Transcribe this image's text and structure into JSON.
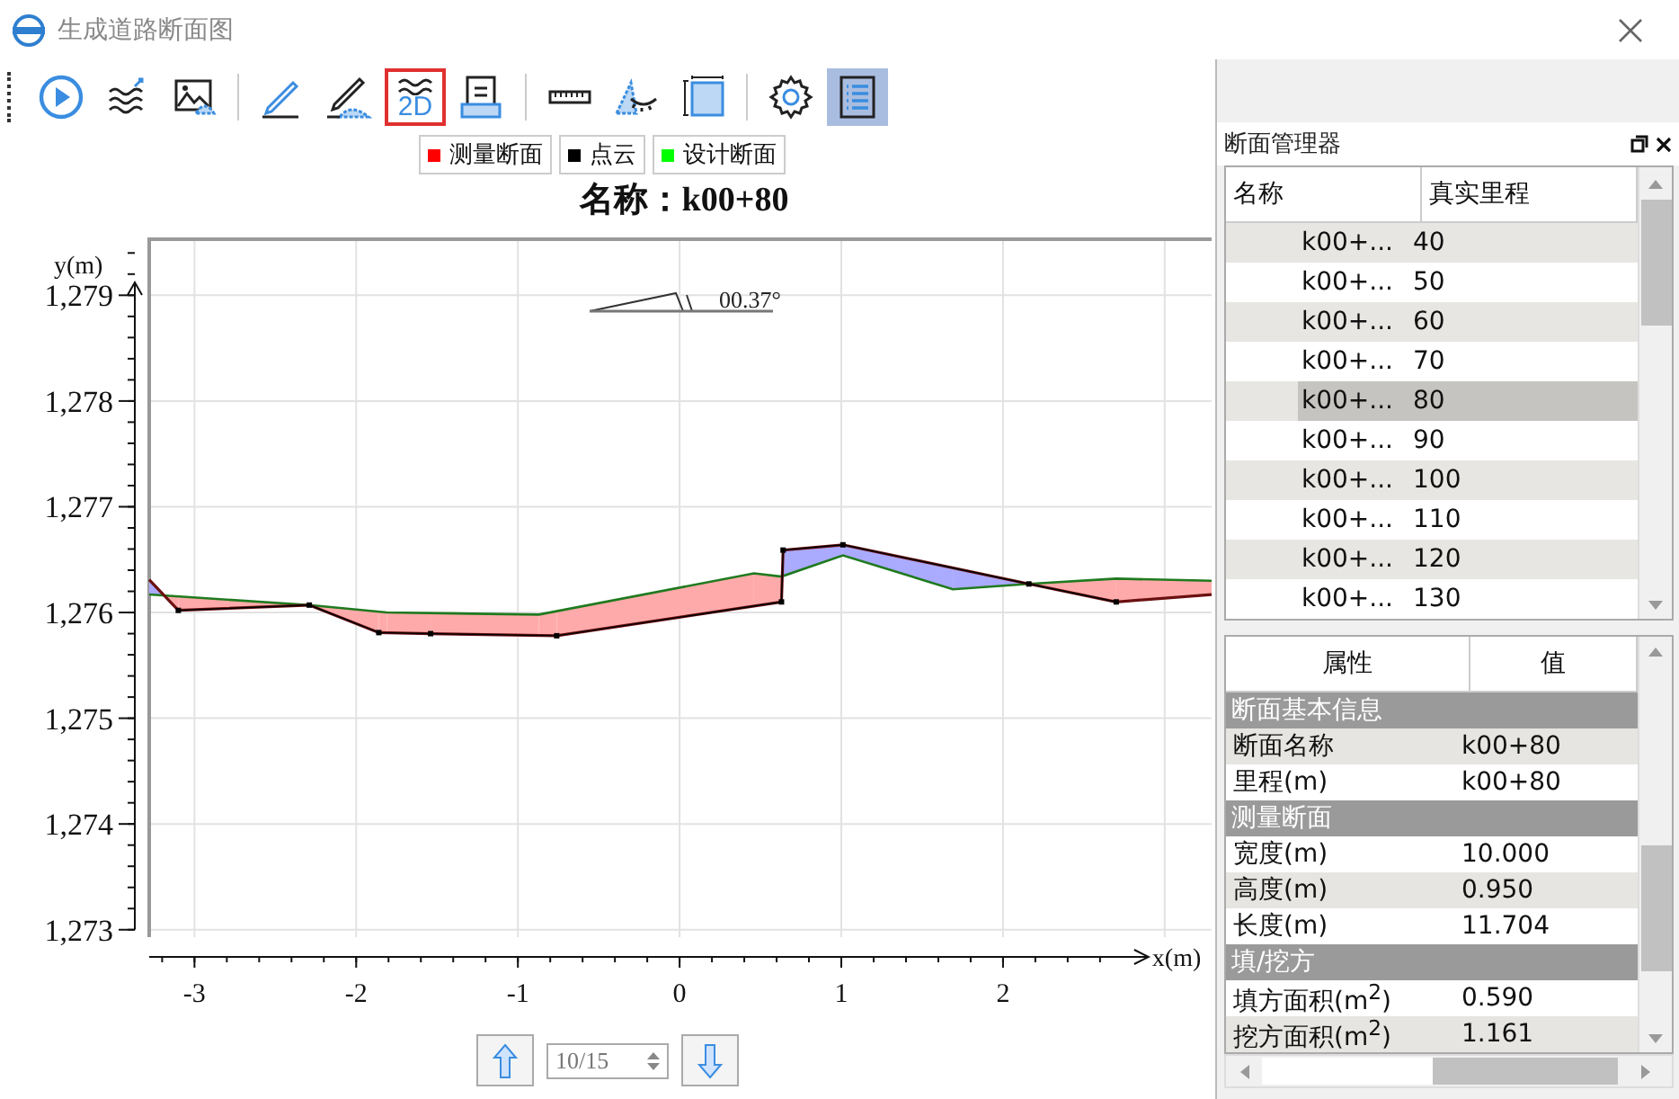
{
  "window": {
    "title": "生成道路断面图"
  },
  "toolbar": [
    {
      "kind": "play",
      "selected": false,
      "on": false
    },
    {
      "kind": "waves",
      "selected": false,
      "on": false
    },
    {
      "kind": "image",
      "selected": false,
      "on": false
    },
    {
      "kind": "separator"
    },
    {
      "kind": "pencil-line",
      "selected": false,
      "on": false
    },
    {
      "kind": "pencil-area",
      "selected": false,
      "on": false
    },
    {
      "kind": "wave-2d",
      "label": "2D",
      "selected": true,
      "on": false
    },
    {
      "kind": "tray",
      "selected": false,
      "on": false
    },
    {
      "kind": "separator"
    },
    {
      "kind": "ruler",
      "selected": false,
      "on": false
    },
    {
      "kind": "eye-area",
      "selected": false,
      "on": false
    },
    {
      "kind": "square",
      "selected": false,
      "on": false
    },
    {
      "kind": "separator"
    },
    {
      "kind": "gear",
      "selected": false,
      "on": false
    },
    {
      "kind": "list",
      "selected": false,
      "on": true
    }
  ],
  "chart": {
    "chart_data": {
      "type": "line",
      "title": "名称：k00+80",
      "xlabel": "x(m)",
      "ylabel": "y(m)",
      "x": [
        -3.28,
        -3.1,
        -2.29,
        -1.86,
        -1.81,
        -1.54,
        -0.87,
        -0.76,
        0.46,
        0.63,
        0.64,
        1.01,
        1.69,
        2.16,
        2.7,
        3.29
      ],
      "grid": true,
      "series": [
        {
          "name": "测量断面",
          "color": "#6b1010",
          "values": [
            1276.31,
            1276.02,
            1276.07,
            1275.81,
            null,
            1275.8,
            null,
            1275.78,
            null,
            1276.1,
            1276.59,
            1276.64,
            null,
            1276.27,
            1276.1,
            1276.17
          ]
        },
        {
          "name": "点云",
          "color": "#000000",
          "marker": "square",
          "values": [
            null,
            1276.02,
            1276.07,
            1275.81,
            null,
            1275.8,
            null,
            1275.78,
            null,
            1276.1,
            1276.59,
            1276.64,
            null,
            1276.27,
            1276.1,
            null
          ]
        },
        {
          "name": "设计断面",
          "color": "#1f7a1f",
          "values": [
            1276.17,
            null,
            1276.07,
            null,
            1276.0,
            null,
            1275.98,
            null,
            1276.37,
            1276.34,
            null,
            1276.54,
            1276.22,
            1276.27,
            1276.32,
            1276.3
          ]
        }
      ],
      "xlim": [
        -3.28,
        3.29
      ],
      "ylim": [
        1272.93,
        1279.53
      ],
      "xticks": [
        -3,
        -2,
        -1,
        0,
        1,
        2
      ],
      "yticks": [
        {
          "value": 1273,
          "label": "1,273"
        },
        {
          "value": 1274,
          "label": "1,274"
        },
        {
          "value": 1275,
          "label": "1,275"
        },
        {
          "value": 1276,
          "label": "1,276"
        },
        {
          "value": 1277,
          "label": "1,277"
        },
        {
          "value": 1278,
          "label": "1,278"
        },
        {
          "value": 1279,
          "label": "1,279"
        }
      ],
      "annotations": [
        {
          "text": "00.37°"
        }
      ]
    }
  },
  "legend": [
    {
      "color": "#ff0000"
    },
    {
      "color": "#000000"
    },
    {
      "color": "#00ff00"
    }
  ],
  "pager": {
    "value": "10/15"
  },
  "section_manager": {
    "title": "断面管理器",
    "columns": [
      "名称",
      "真实里程"
    ],
    "rows": [
      {
        "name": "k00+...",
        "mileage": "40",
        "selected": false
      },
      {
        "name": "k00+...",
        "mileage": "50",
        "selected": false
      },
      {
        "name": "k00+...",
        "mileage": "60",
        "selected": false
      },
      {
        "name": "k00+...",
        "mileage": "70",
        "selected": false
      },
      {
        "name": "k00+...",
        "mileage": "80",
        "selected": true
      },
      {
        "name": "k00+...",
        "mileage": "90",
        "selected": false
      },
      {
        "name": "k00+...",
        "mileage": "100",
        "selected": false
      },
      {
        "name": "k00+...",
        "mileage": "110",
        "selected": false
      },
      {
        "name": "k00+...",
        "mileage": "120",
        "selected": false
      },
      {
        "name": "k00+...",
        "mileage": "130",
        "selected": false
      }
    ]
  },
  "properties": {
    "columns": [
      "属性",
      "值"
    ],
    "groups": [
      {
        "title": "断面基本信息",
        "rows": [
          {
            "name": "断面名称",
            "value": "k00+80",
            "shaded": true
          },
          {
            "name": "里程(m)",
            "value": "k00+80",
            "shaded": false
          }
        ]
      },
      {
        "title": "测量断面",
        "rows": [
          {
            "name": "宽度(m)",
            "value": "10.000",
            "shaded": false
          },
          {
            "name": "高度(m)",
            "value": "0.950",
            "shaded": true
          },
          {
            "name": "长度(m)",
            "value": "11.704",
            "shaded": false
          }
        ]
      },
      {
        "title": "填/挖方",
        "rows": [
          {
            "name": "填方面积(m$^{2}$)",
            "value": "0.590",
            "shaded": false
          },
          {
            "name": "挖方面积(m$^{2}$)",
            "value": "1.161",
            "shaded": true
          }
        ]
      }
    ]
  }
}
